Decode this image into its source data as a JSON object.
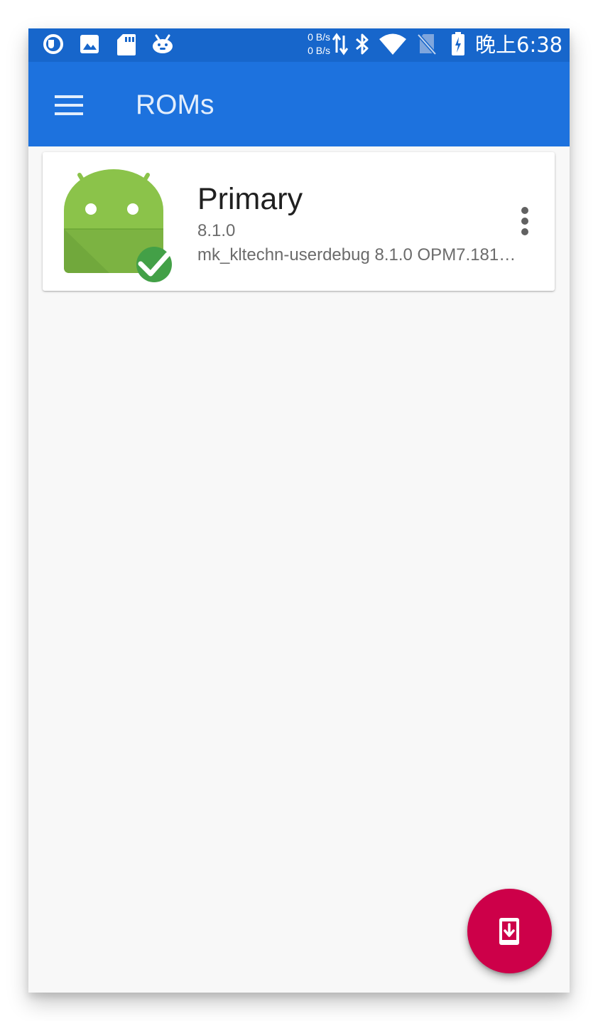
{
  "status_bar": {
    "net_speed_up": "0 B/s",
    "net_speed_down": "0 B/s",
    "time": "晚上6:38",
    "left_icons": [
      "app-notification-icon",
      "image-icon",
      "sd-card-icon",
      "robot-notification-icon"
    ],
    "right_icons": [
      "data-transfer-arrows-icon",
      "bluetooth-icon",
      "wifi-icon",
      "no-sim-icon",
      "battery-charging-icon"
    ]
  },
  "app_bar": {
    "title": "ROMs",
    "menu_icon": "hamburger-menu-icon",
    "background_color": "#1d72de"
  },
  "roms": [
    {
      "name": "Primary",
      "version": "8.1.0",
      "build": "mk_kltechn-userdebug 8.1.0 OPM7.181…",
      "icon": "android-robot-icon",
      "status_icon": "check-circle-icon",
      "active": true
    }
  ],
  "fab": {
    "icon": "phone-download-icon",
    "color": "#cd0049"
  },
  "colors": {
    "status_bar": "#1766cb",
    "android_green": "#8bc34a",
    "check_green": "#43a047"
  }
}
